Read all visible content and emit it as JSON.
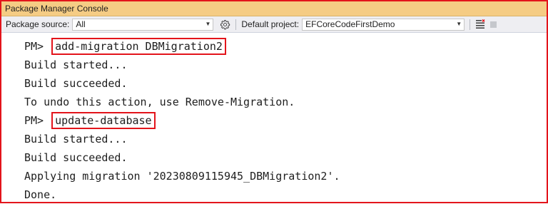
{
  "window": {
    "title": "Package Manager Console"
  },
  "toolbar": {
    "source_label": "Package source:",
    "source_value": "All",
    "project_label": "Default project:",
    "project_value": "EFCoreCodeFirstDemo"
  },
  "console": {
    "lines": [
      {
        "prompt": "PM>",
        "command": "add-migration DBMigration2"
      },
      {
        "text": "Build started..."
      },
      {
        "text": "Build succeeded."
      },
      {
        "text": "To undo this action, use Remove-Migration."
      },
      {
        "prompt": "PM>",
        "command": "update-database"
      },
      {
        "text": "Build started..."
      },
      {
        "text": "Build succeeded."
      },
      {
        "text": "Applying migration '20230809115945_DBMigration2'."
      },
      {
        "text": "Done."
      }
    ]
  },
  "icons": {
    "settings": "gear-icon",
    "clear": "clear-console-icon",
    "stop": "stop-icon",
    "dropdown": "chevron-down-icon"
  },
  "colors": {
    "title_bar": "#f5cc84",
    "highlight": "#e3141b",
    "toolbar": "#eeeef2"
  }
}
